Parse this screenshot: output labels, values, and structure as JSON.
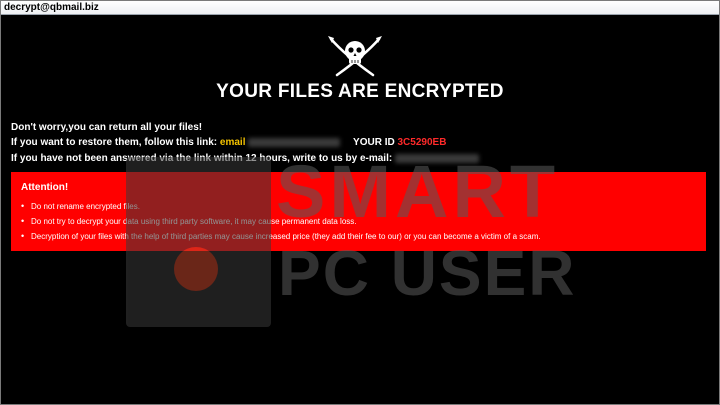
{
  "window": {
    "title": "decrypt@qbmail.biz"
  },
  "logo": {
    "icon": "skull-crossed-swords-icon"
  },
  "headline": "YOUR FILES ARE ENCRYPTED",
  "message": {
    "line1": "Don't worry,you can return all your files!",
    "line2_prefix": "If you want to restore them, follow this link:",
    "line2_email_label": "email",
    "line2_id_label": "YOUR ID",
    "line2_id_value": "3C5290EB",
    "line3": "If you have not been answered via the link within 12 hours, write to us by e-mail:"
  },
  "attention": {
    "title": "Attention!",
    "items": [
      "Do not rename encrypted files.",
      "Do not try to decrypt your data using third party software, it may cause permanent data loss.",
      "Decryption of your files with the help of third parties may cause increased price (they add their fee to our) or you can become a victim of a scam."
    ]
  },
  "watermark": {
    "line1": "SMART",
    "line2": "PC USER"
  },
  "colors": {
    "background": "#000000",
    "alert": "#ff0000",
    "email_label": "#f5c400",
    "id_value": "#ff2a2a"
  }
}
